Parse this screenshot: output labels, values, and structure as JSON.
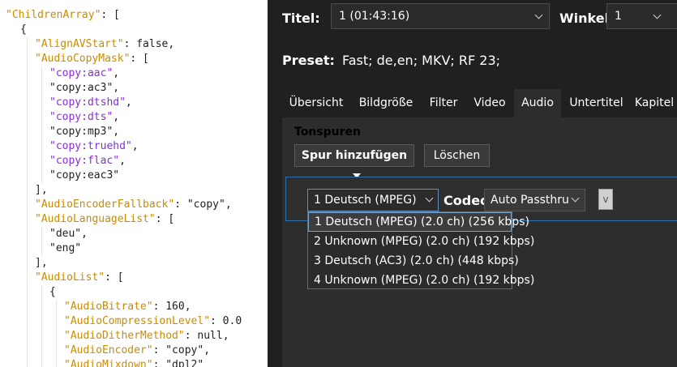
{
  "code": {
    "lines": [
      {
        "indent": 0,
        "guides": [],
        "parts": [
          [
            "tok-key",
            "\"ChildrenArray\""
          ],
          [
            "tok-punc",
            ": ["
          ]
        ]
      },
      {
        "indent": 1,
        "guides": [],
        "parts": [
          [
            "tok-punc",
            "{"
          ]
        ]
      },
      {
        "indent": 2,
        "guides": [
          1
        ],
        "parts": [
          [
            "tok-key",
            "\"AlignAVStart\""
          ],
          [
            "tok-punc",
            ": "
          ],
          [
            "tok-val",
            "false"
          ],
          [
            "tok-punc",
            ","
          ]
        ]
      },
      {
        "indent": 2,
        "guides": [
          1
        ],
        "parts": [
          [
            "tok-key",
            "\"AudioCopyMask\""
          ],
          [
            "tok-punc",
            ": ["
          ]
        ]
      },
      {
        "indent": 3,
        "guides": [
          1,
          2
        ],
        "parts": [
          [
            "tok-strp",
            "\"copy:aac\""
          ],
          [
            "tok-punc",
            ","
          ]
        ]
      },
      {
        "indent": 3,
        "guides": [
          1,
          2
        ],
        "parts": [
          [
            "tok-str",
            "\"copy:ac3\""
          ],
          [
            "tok-punc",
            ","
          ]
        ]
      },
      {
        "indent": 3,
        "guides": [
          1,
          2
        ],
        "parts": [
          [
            "tok-strp",
            "\"copy:dtshd\""
          ],
          [
            "tok-punc",
            ","
          ]
        ]
      },
      {
        "indent": 3,
        "guides": [
          1,
          2
        ],
        "parts": [
          [
            "tok-strp",
            "\"copy:dts\""
          ],
          [
            "tok-punc",
            ","
          ]
        ]
      },
      {
        "indent": 3,
        "guides": [
          1,
          2
        ],
        "parts": [
          [
            "tok-str",
            "\"copy:mp3\""
          ],
          [
            "tok-punc",
            ","
          ]
        ]
      },
      {
        "indent": 3,
        "guides": [
          1,
          2
        ],
        "parts": [
          [
            "tok-strp",
            "\"copy:truehd\""
          ],
          [
            "tok-punc",
            ","
          ]
        ]
      },
      {
        "indent": 3,
        "guides": [
          1,
          2
        ],
        "parts": [
          [
            "tok-strp",
            "\"copy:flac\""
          ],
          [
            "tok-punc",
            ","
          ]
        ]
      },
      {
        "indent": 3,
        "guides": [
          1,
          2
        ],
        "parts": [
          [
            "tok-str",
            "\"copy:eac3\""
          ]
        ]
      },
      {
        "indent": 2,
        "guides": [
          1
        ],
        "parts": [
          [
            "tok-punc",
            "],"
          ]
        ]
      },
      {
        "indent": 2,
        "guides": [
          1
        ],
        "parts": [
          [
            "tok-key",
            "\"AudioEncoderFallback\""
          ],
          [
            "tok-punc",
            ": "
          ],
          [
            "tok-str",
            "\"copy\""
          ],
          [
            "tok-punc",
            ","
          ]
        ]
      },
      {
        "indent": 2,
        "guides": [
          1
        ],
        "parts": [
          [
            "tok-key",
            "\"AudioLanguageList\""
          ],
          [
            "tok-punc",
            ": ["
          ]
        ]
      },
      {
        "indent": 3,
        "guides": [
          1,
          2
        ],
        "parts": [
          [
            "tok-str",
            "\"deu\""
          ],
          [
            "tok-punc",
            ","
          ]
        ]
      },
      {
        "indent": 3,
        "guides": [
          1,
          2
        ],
        "parts": [
          [
            "tok-str",
            "\"eng\""
          ]
        ]
      },
      {
        "indent": 2,
        "guides": [
          1
        ],
        "parts": [
          [
            "tok-punc",
            "],"
          ]
        ]
      },
      {
        "indent": 2,
        "guides": [
          1
        ],
        "parts": [
          [
            "tok-key",
            "\"AudioList\""
          ],
          [
            "tok-punc",
            ": ["
          ]
        ]
      },
      {
        "indent": 3,
        "guides": [
          1,
          2
        ],
        "parts": [
          [
            "tok-punc",
            "{"
          ]
        ]
      },
      {
        "indent": 4,
        "guides": [
          1,
          2,
          3
        ],
        "parts": [
          [
            "tok-key",
            "\"AudioBitrate\""
          ],
          [
            "tok-punc",
            ": "
          ],
          [
            "tok-val",
            "160"
          ],
          [
            "tok-punc",
            ","
          ]
        ]
      },
      {
        "indent": 4,
        "guides": [
          1,
          2,
          3
        ],
        "parts": [
          [
            "tok-key",
            "\"AudioCompressionLevel\""
          ],
          [
            "tok-punc",
            ": "
          ],
          [
            "tok-val",
            "0.0"
          ]
        ]
      },
      {
        "indent": 4,
        "guides": [
          1,
          2,
          3
        ],
        "parts": [
          [
            "tok-key",
            "\"AudioDitherMethod\""
          ],
          [
            "tok-punc",
            ": "
          ],
          [
            "tok-val",
            "null"
          ],
          [
            "tok-punc",
            ","
          ]
        ]
      },
      {
        "indent": 4,
        "guides": [
          1,
          2,
          3
        ],
        "parts": [
          [
            "tok-key",
            "\"AudioEncoder\""
          ],
          [
            "tok-punc",
            ": "
          ],
          [
            "tok-str",
            "\"copy\""
          ],
          [
            "tok-punc",
            ","
          ]
        ]
      },
      {
        "indent": 4,
        "guides": [
          1,
          2,
          3
        ],
        "parts": [
          [
            "tok-key",
            "\"AudioMixdown\""
          ],
          [
            "tok-punc",
            ": "
          ],
          [
            "tok-str",
            "\"dpl2\""
          ]
        ]
      }
    ]
  },
  "header": {
    "title_label": "Titel:",
    "title_value": "1  (01:43:16)",
    "angle_label": "Winkel:",
    "angle_value": "1",
    "preset_label": "Preset:",
    "preset_value": "Fast; de,en; MKV; RF 23;"
  },
  "tabs": [
    {
      "label": "Übersicht",
      "active": false
    },
    {
      "label": "Bildgröße",
      "active": false
    },
    {
      "label": "Filter",
      "active": false
    },
    {
      "label": "Video",
      "active": false
    },
    {
      "label": "Audio",
      "active": true
    },
    {
      "label": "Untertitel",
      "active": false
    },
    {
      "label": "Kapitel",
      "active": false
    }
  ],
  "audio": {
    "section_title": "Tonspuren",
    "add_track_label": "Spur hinzufügen",
    "delete_label": "Löschen",
    "track_selected": "1 Deutsch (MPEG) (2.0 ch) (256 kbps)",
    "codec_label": "Codec",
    "codec_value": "Auto Passthru",
    "mini_box": "v",
    "track_options": [
      {
        "label": "1 Deutsch (MPEG) (2.0 ch) (256 kbps)",
        "selected": true
      },
      {
        "label": "2 Unknown (MPEG) (2.0 ch) (192 kbps)",
        "selected": false
      },
      {
        "label": "3 Deutsch (AC3) (2.0 ch) (448 kbps)",
        "selected": false
      },
      {
        "label": "4 Unknown (MPEG) (2.0 ch) (192 kbps)",
        "selected": false
      }
    ]
  }
}
